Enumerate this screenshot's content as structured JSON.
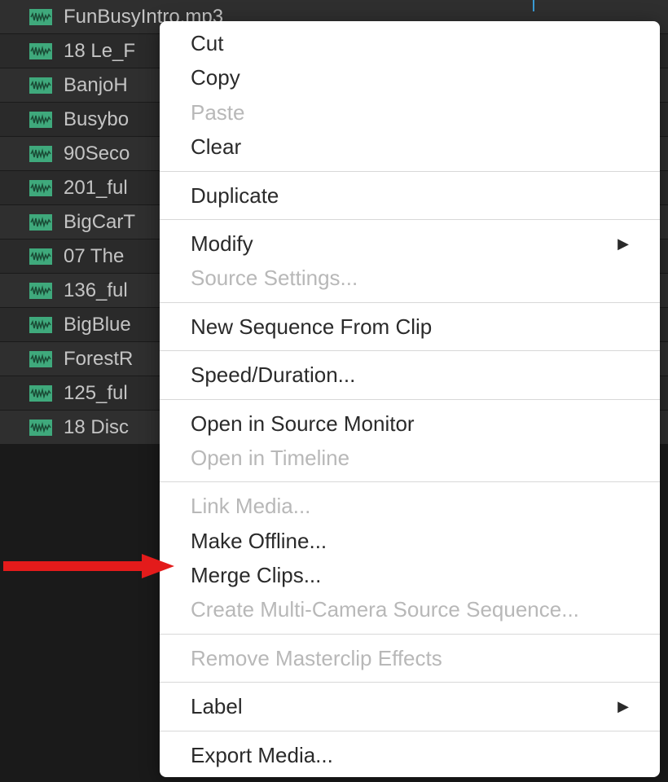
{
  "files": [
    {
      "name": "FunBusyIntro.mp3"
    },
    {
      "name": "18 Le_F"
    },
    {
      "name": "BanjoH"
    },
    {
      "name": "Busybo"
    },
    {
      "name": "90Seco"
    },
    {
      "name": "201_ful"
    },
    {
      "name": "BigCarT"
    },
    {
      "name": "07 The"
    },
    {
      "name": "136_ful"
    },
    {
      "name": "BigBlue"
    },
    {
      "name": "ForestR"
    },
    {
      "name": "125_ful"
    },
    {
      "name": "18 Disc"
    }
  ],
  "menu": {
    "groups": [
      [
        {
          "label": "Cut",
          "disabled": false,
          "submenu": false
        },
        {
          "label": "Copy",
          "disabled": false,
          "submenu": false
        },
        {
          "label": "Paste",
          "disabled": true,
          "submenu": false
        },
        {
          "label": "Clear",
          "disabled": false,
          "submenu": false
        }
      ],
      [
        {
          "label": "Duplicate",
          "disabled": false,
          "submenu": false
        }
      ],
      [
        {
          "label": "Modify",
          "disabled": false,
          "submenu": true
        },
        {
          "label": "Source Settings...",
          "disabled": true,
          "submenu": false
        }
      ],
      [
        {
          "label": "New Sequence From Clip",
          "disabled": false,
          "submenu": false
        }
      ],
      [
        {
          "label": "Speed/Duration...",
          "disabled": false,
          "submenu": false
        }
      ],
      [
        {
          "label": "Open in Source Monitor",
          "disabled": false,
          "submenu": false
        },
        {
          "label": "Open in Timeline",
          "disabled": true,
          "submenu": false
        }
      ],
      [
        {
          "label": "Link Media...",
          "disabled": true,
          "submenu": false
        },
        {
          "label": "Make Offline...",
          "disabled": false,
          "submenu": false
        },
        {
          "label": "Merge Clips...",
          "disabled": false,
          "submenu": false
        },
        {
          "label": "Create Multi-Camera Source Sequence...",
          "disabled": true,
          "submenu": false
        }
      ],
      [
        {
          "label": "Remove Masterclip Effects",
          "disabled": true,
          "submenu": false
        }
      ],
      [
        {
          "label": "Label",
          "disabled": false,
          "submenu": true
        }
      ],
      [
        {
          "label": "Export Media...",
          "disabled": false,
          "submenu": false
        }
      ]
    ]
  },
  "annotation": {
    "arrow_color": "#e31b1b"
  }
}
